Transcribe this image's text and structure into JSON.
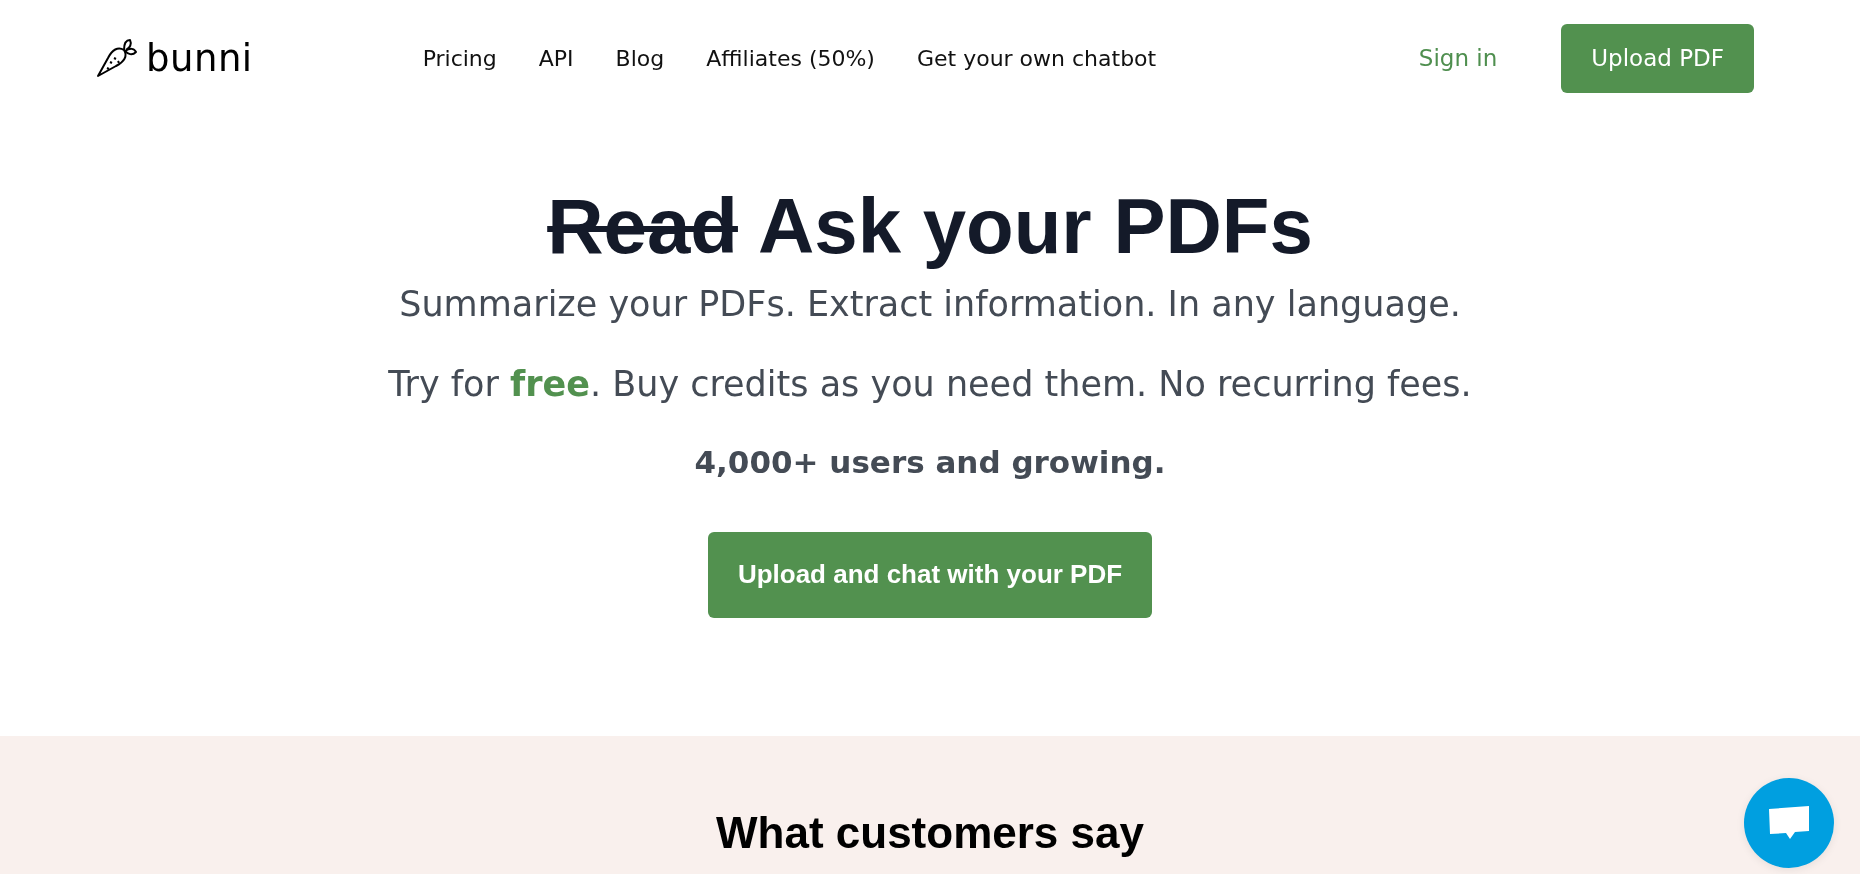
{
  "header": {
    "logo": "bunni",
    "nav": [
      "Pricing",
      "API",
      "Blog",
      "Affiliates (50%)",
      "Get your own chatbot"
    ],
    "sign_in": "Sign in",
    "upload_button": "Upload PDF"
  },
  "hero": {
    "struck_word": "Read",
    "headline": "Ask your PDFs",
    "tagline": "Summarize your PDFs. Extract information. In any language.",
    "offer": "Try for **free**. Buy credits as you need them. No recurring fees.",
    "users": "4,000+ users and growing.",
    "cta": "Upload and chat with your PDF"
  },
  "testimonials": {
    "title": "What customers say"
  }
}
